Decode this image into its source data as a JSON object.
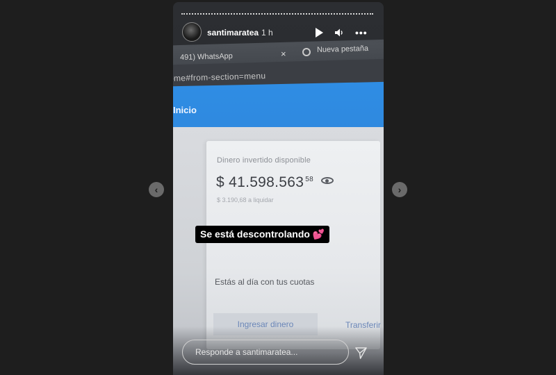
{
  "story": {
    "username": "santimaratea",
    "time": "1 h",
    "caption": "Se está descontrolando 💕",
    "reply_placeholder": "Responde a santimaratea..."
  },
  "photo": {
    "tab_title": "491) WhatsApp",
    "tab_close": "×",
    "new_tab_label": "Nueva pestaña",
    "url_text": "ome#from-section=menu",
    "header_title": "Inicio",
    "card_label": "Dinero invertido disponible",
    "amount_main": "$ 41.598.563",
    "amount_cents": "58",
    "sub_amount": "$ 3.190,68 a liquidar",
    "cuotas_text": "Estás al día con tus cuotas",
    "btn_ingresar": "Ingresar dinero",
    "btn_transfer": "Transferir"
  },
  "icons": {
    "prev": "‹",
    "next": "›",
    "more": "•••"
  }
}
